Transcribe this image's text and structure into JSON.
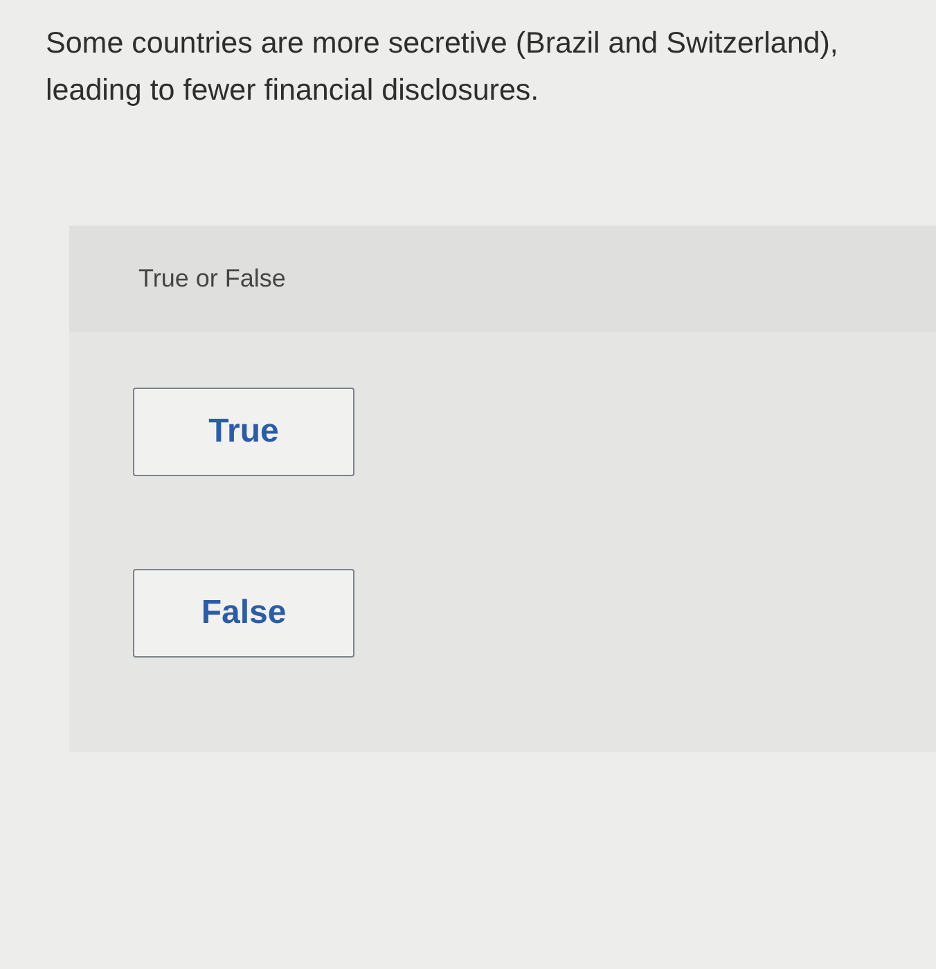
{
  "question": {
    "text": "Some countries are more secretive (Brazil and Switzerland), leading to fewer financial disclosures."
  },
  "panel": {
    "prompt": "True or False",
    "options": [
      {
        "label": "True",
        "selected": false
      },
      {
        "label": "False",
        "selected": false
      }
    ]
  }
}
